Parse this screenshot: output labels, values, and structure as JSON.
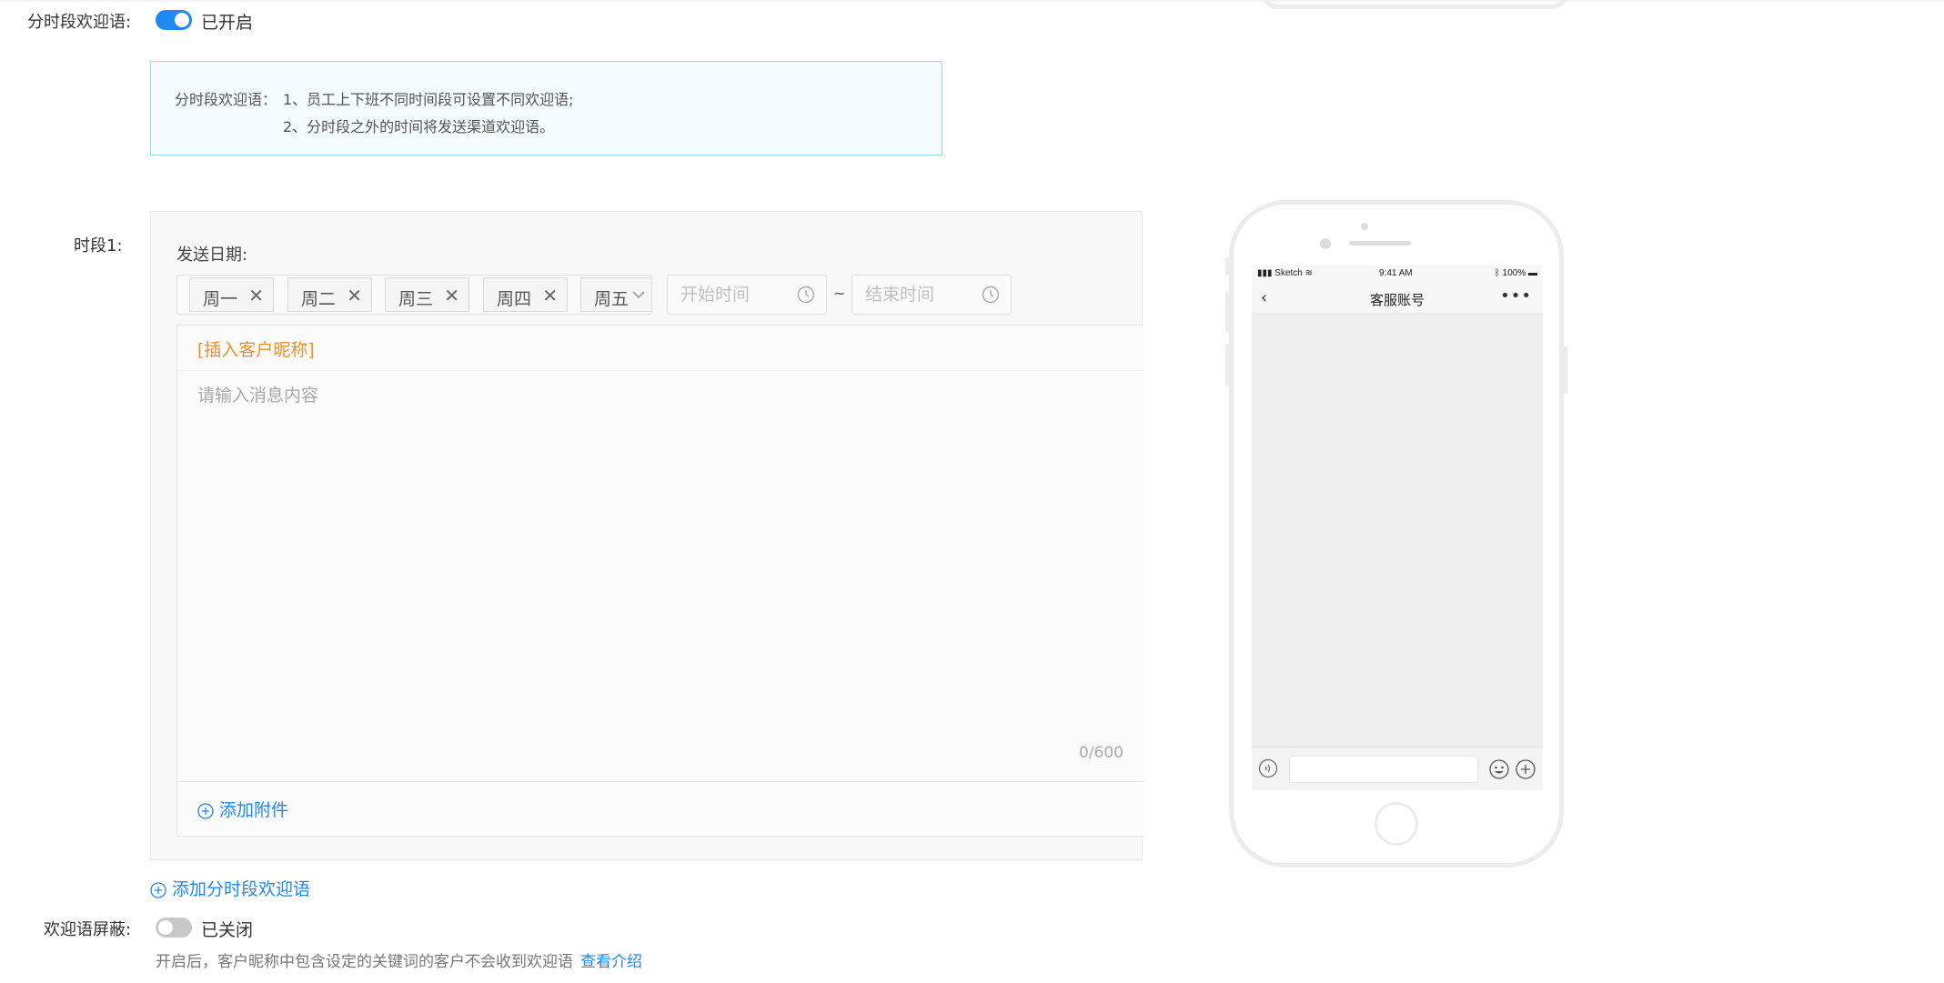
{
  "time_greeting": {
    "label": "分时段欢迎语:",
    "switch_state": "已开启",
    "enabled": true,
    "info_prefix": "分时段欢迎语：",
    "info_lines": [
      "1、员工上下班不同时间段可设置不同欢迎语;",
      "2、分时段之外的时间将发送渠道欢迎语。"
    ]
  },
  "slot": {
    "label": "时段1:",
    "date_label": "发送日期:",
    "days": [
      "周一",
      "周二",
      "周三",
      "周四",
      "周五"
    ],
    "start_placeholder": "开始时间",
    "end_placeholder": "结束时间",
    "separator": "~",
    "insert_name": "[插入客户昵称]",
    "message_placeholder": "请输入消息内容",
    "char_count": "0/600",
    "add_attachment": "添加附件"
  },
  "add_slot": "添加分时段欢迎语",
  "mask": {
    "label": "欢迎语屏蔽:",
    "switch_state": "已关闭",
    "enabled": false,
    "description": "开启后，客户昵称中包含设定的关键词的客户不会收到欢迎语",
    "link": "查看介绍"
  },
  "phone": {
    "carrier": "Sketch",
    "time": "9:41 AM",
    "battery": "100%",
    "nav_title": "客服账号",
    "more": "•••"
  },
  "colors": {
    "accent": "#1e88f5",
    "insert": "#e6922e",
    "info_border": "#9fd8ec"
  }
}
